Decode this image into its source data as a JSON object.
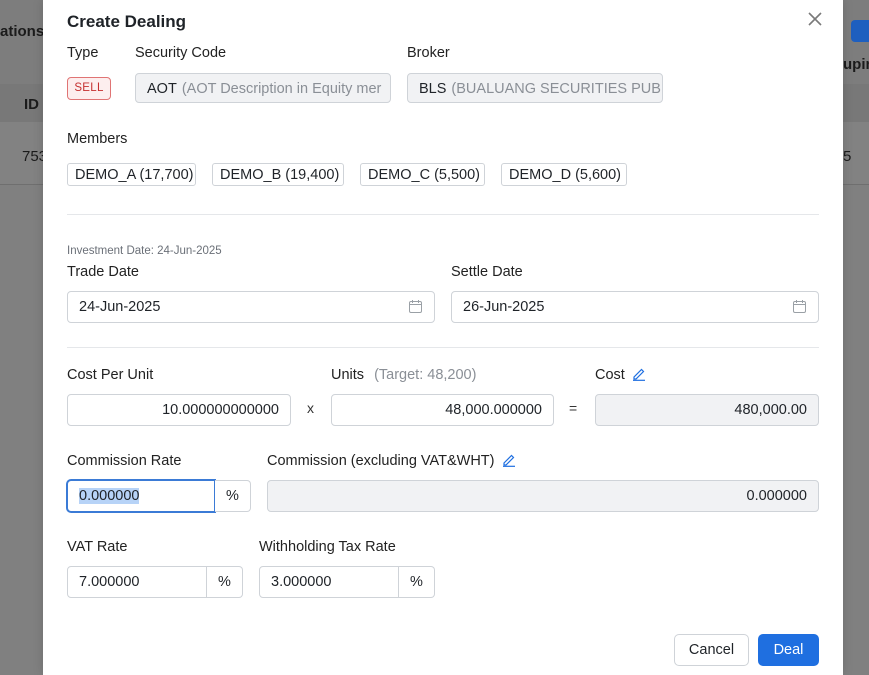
{
  "background": {
    "header_partial": "ations",
    "col_id": "ID",
    "col_right_partial": "uping",
    "row_id_partial": "753",
    "row_right_partial": "5"
  },
  "modal": {
    "title": "Create Dealing",
    "type_label": "Type",
    "type_value": "SELL",
    "security_label": "Security Code",
    "security_code": "AOT",
    "security_desc": "(AOT Description in Equity mer",
    "broker_label": "Broker",
    "broker_code": "BLS",
    "broker_desc": "(BUALUANG SECURITIES PUBL",
    "members_label": "Members",
    "members": [
      "DEMO_A (17,700)",
      "DEMO_B (19,400)",
      "DEMO_C (5,500)",
      "DEMO_D (5,600)"
    ],
    "investment_date_note": "Investment Date: 24-Jun-2025",
    "trade_date_label": "Trade Date",
    "trade_date": "24-Jun-2025",
    "settle_date_label": "Settle Date",
    "settle_date": "26-Jun-2025",
    "cost_per_unit_label": "Cost Per Unit",
    "cost_per_unit": "10.000000000000",
    "times_op": "x",
    "units_label": "Units",
    "units_hint": "(Target: 48,200)",
    "units": "48,000.000000",
    "equals_op": "=",
    "cost_label": "Cost",
    "cost": "480,000.00",
    "commission_rate_label": "Commission Rate",
    "commission_rate": "0.000000",
    "percent": "%",
    "commission_label": "Commission (excluding VAT&WHT)",
    "commission": "0.000000",
    "vat_rate_label": "VAT Rate",
    "vat_rate": "7.000000",
    "wht_rate_label": "Withholding Tax Rate",
    "wht_rate": "3.000000",
    "cancel_label": "Cancel",
    "deal_label": "Deal"
  },
  "colors": {
    "accent": "#1f6fe0",
    "sell_badge": "#c53030"
  }
}
